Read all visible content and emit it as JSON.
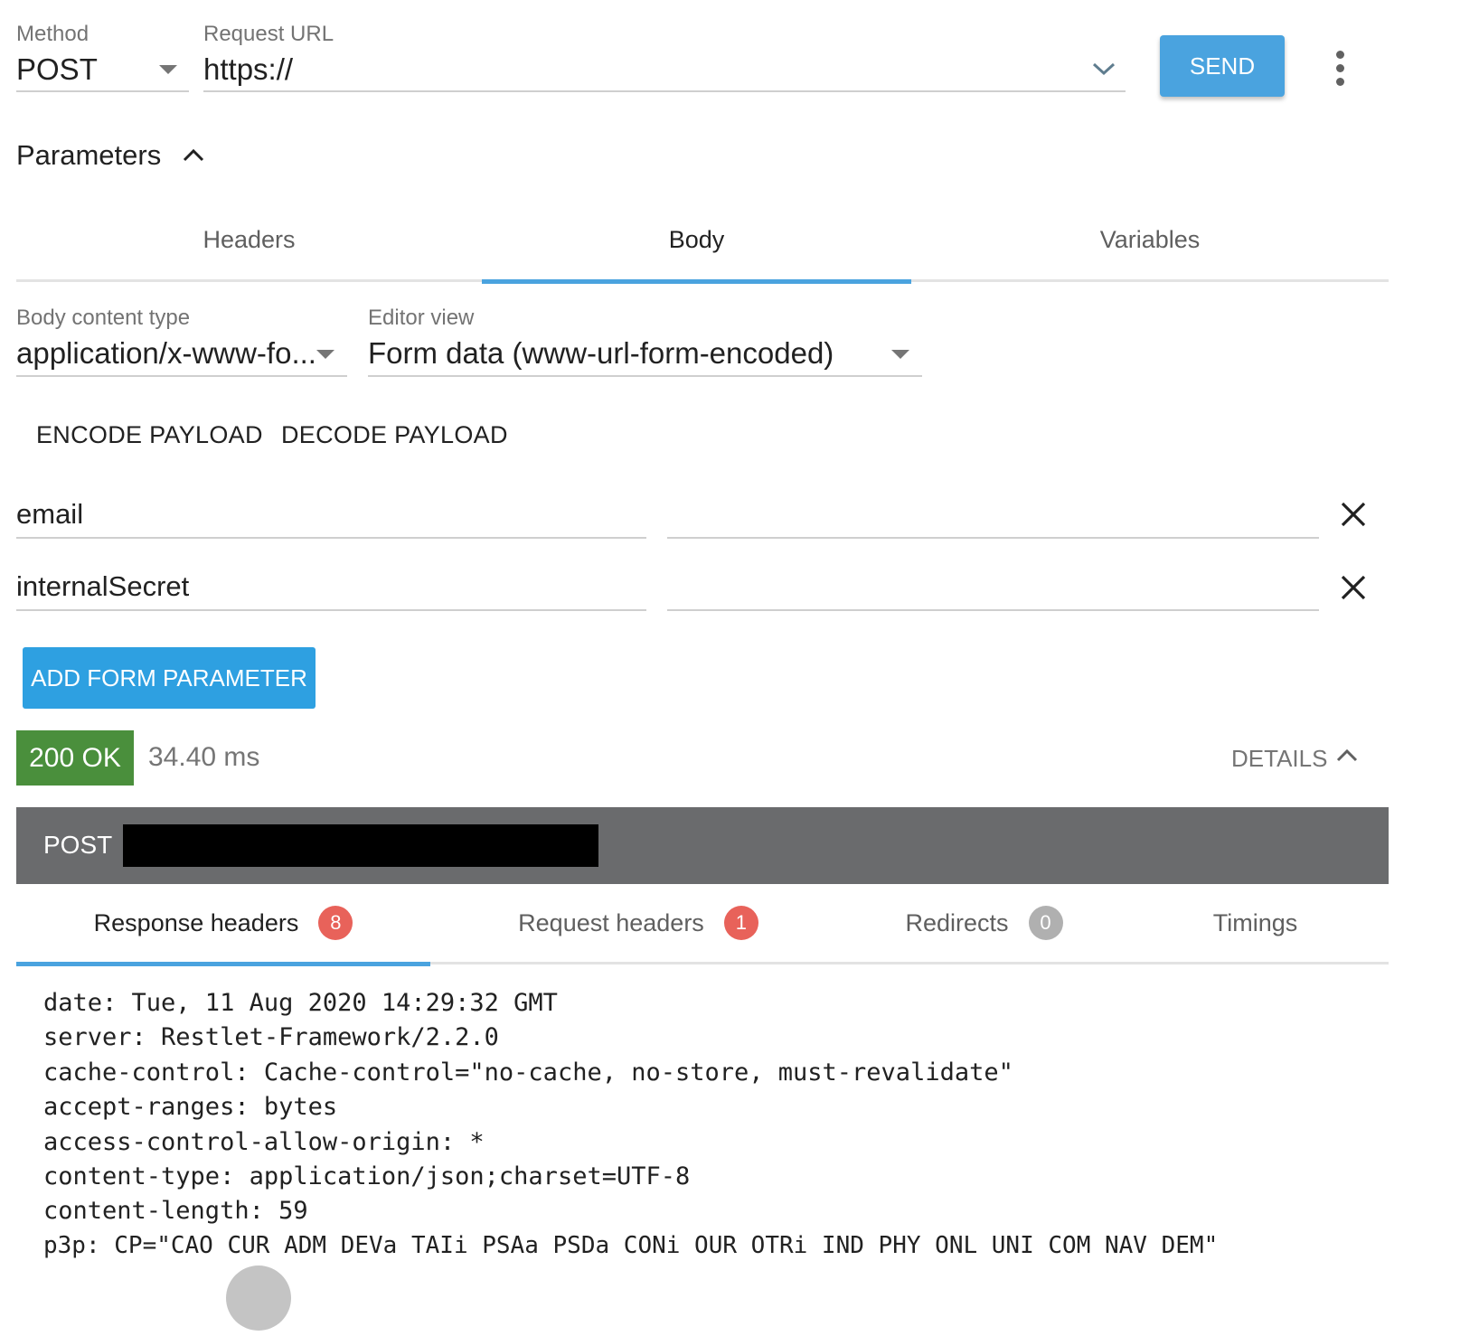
{
  "request": {
    "method_label": "Method",
    "method_value": "POST",
    "url_label": "Request URL",
    "url_value": "https://",
    "send_label": "SEND"
  },
  "parameters": {
    "title": "Parameters",
    "tabs": [
      {
        "label": "Headers",
        "active": false
      },
      {
        "label": "Body",
        "active": true
      },
      {
        "label": "Variables",
        "active": false
      }
    ]
  },
  "body": {
    "content_type_label": "Body content type",
    "content_type_value": "application/x-www-fo...",
    "editor_view_label": "Editor view",
    "editor_view_value": "Form data (www-url-form-encoded)",
    "encode_label": "ENCODE PAYLOAD",
    "decode_label": "DECODE PAYLOAD",
    "form_params": [
      {
        "name": "email",
        "value": ""
      },
      {
        "name": "internalSecret",
        "value": ""
      }
    ],
    "add_label": "ADD FORM PARAMETER"
  },
  "response": {
    "status": "200 OK",
    "time": "34.40 ms",
    "details_label": "DETAILS",
    "request_method": "POST",
    "tabs": [
      {
        "label": "Response headers",
        "count": "8",
        "active": true
      },
      {
        "label": "Request headers",
        "count": "1",
        "active": false
      },
      {
        "label": "Redirects",
        "count": "0",
        "active": false
      },
      {
        "label": "Timings",
        "count": null,
        "active": false
      }
    ],
    "headers": [
      "date: Tue, 11 Aug 2020 14:29:32 GMT",
      "server: Restlet-Framework/2.2.0",
      "cache-control: Cache-control=\"no-cache, no-store, must-revalidate\"",
      "accept-ranges: bytes",
      "access-control-allow-origin: *",
      "content-type: application/json;charset=UTF-8",
      "content-length: 59",
      "p3p: CP=\"CAO CUR ADM DEVa TAIi PSAa PSDa CONi OUR OTRi IND PHY ONL UNI COM NAV DEM\""
    ]
  },
  "colors": {
    "accent": "#4aa3df",
    "status_ok": "#4a8f3c",
    "badge_red": "#e8625a",
    "badge_grey": "#b0b0b0",
    "url_bar": "#6a6b6d"
  }
}
